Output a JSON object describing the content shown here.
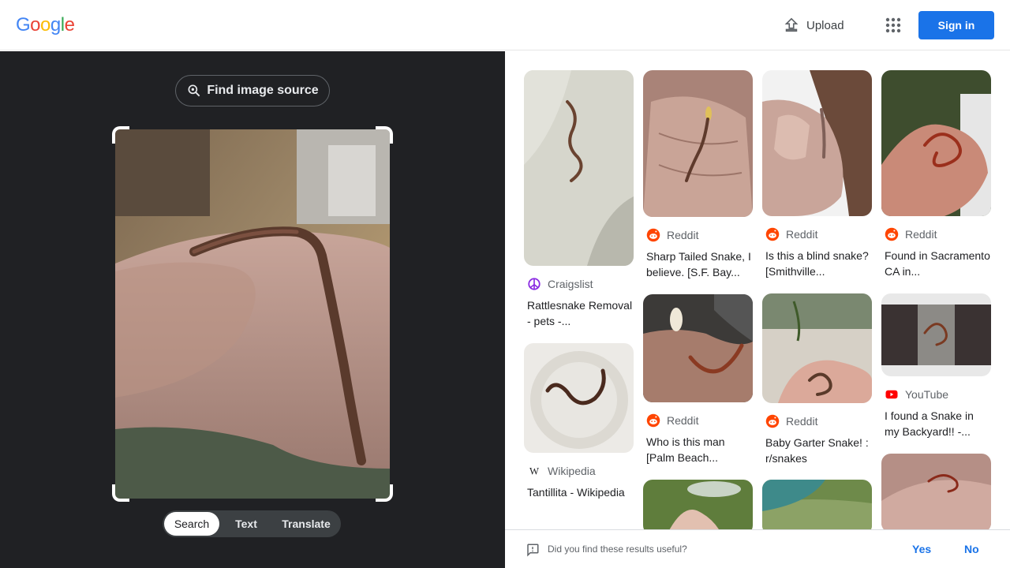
{
  "header": {
    "logo_letters": [
      {
        "ch": "G",
        "color": "#4285F4"
      },
      {
        "ch": "o",
        "color": "#EA4335"
      },
      {
        "ch": "o",
        "color": "#FBBC05"
      },
      {
        "ch": "g",
        "color": "#4285F4"
      },
      {
        "ch": "l",
        "color": "#34A853"
      },
      {
        "ch": "e",
        "color": "#EA4335"
      }
    ],
    "upload_label": "Upload",
    "apps_icon": "apps-grid-icon",
    "signin_label": "Sign in"
  },
  "lens": {
    "find_source_label": "Find image source",
    "modes": [
      "Search",
      "Text",
      "Translate"
    ],
    "active_mode": "Search"
  },
  "results": [
    {
      "source": "Craigslist",
      "source_icon": "craigslist-peace-icon",
      "title": "Rattlesnake Removal - pets -..."
    },
    {
      "source": "Wikipedia",
      "source_icon": "wikipedia-w-icon",
      "title": "Tantillita - Wikipedia"
    },
    {
      "source": "Reddit",
      "source_icon": "reddit-icon",
      "title": "Sharp Tailed Snake, I believe. [S.F. Bay..."
    },
    {
      "source": "Reddit",
      "source_icon": "reddit-icon",
      "title": "Who is this man [Palm Beach..."
    },
    {
      "source": "Reddit",
      "source_icon": "reddit-icon",
      "title": "Is this a blind snake? [Smithville..."
    },
    {
      "source": "Reddit",
      "source_icon": "reddit-icon",
      "title": "Baby Garter Snake! : r/snakes"
    },
    {
      "source": "Reddit",
      "source_icon": "reddit-icon",
      "title": "Found in Sacramento CA in..."
    },
    {
      "source": "YouTube",
      "source_icon": "youtube-icon",
      "title": "I found a Snake in my Backyard!! -..."
    }
  ],
  "feedback": {
    "question": "Did you find these results useful?",
    "yes_label": "Yes",
    "no_label": "No"
  },
  "colors": {
    "accent": "#1a73e8",
    "panel_dark": "#202124",
    "reddit": "#FF4500",
    "youtube": "#FF0000",
    "craigslist": "#8A2BE2"
  }
}
